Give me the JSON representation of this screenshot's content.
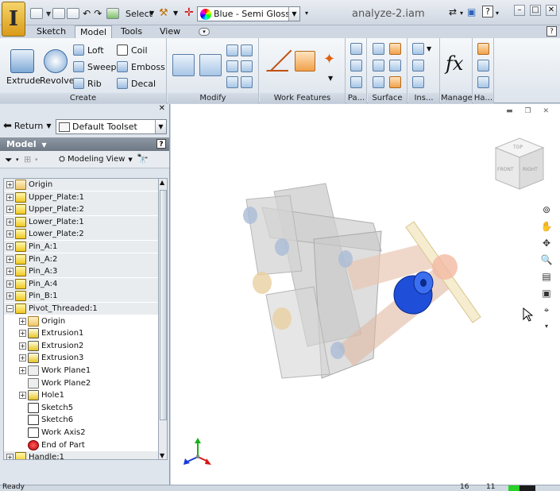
{
  "app": {
    "logo_letter": "I",
    "document_title": "analyze-2.iam",
    "select_label": "Select",
    "color_style": "Blue - Semi Gloss"
  },
  "tabs": [
    {
      "label": "Sketch",
      "active": false
    },
    {
      "label": "Model",
      "active": true
    },
    {
      "label": "Tools",
      "active": false
    },
    {
      "label": "View",
      "active": false
    }
  ],
  "ribbon": {
    "create": {
      "title": "Create",
      "extrude": "Extrude",
      "revolve": "Revolve",
      "loft": "Loft",
      "sweep": "Sweep",
      "rib": "Rib",
      "coil": "Coil",
      "emboss": "Emboss",
      "decal": "Decal"
    },
    "modify": {
      "title": "Modify"
    },
    "work_features": {
      "title": "Work Features"
    },
    "pattern": {
      "title": "Pa..."
    },
    "surface": {
      "title": "Surface"
    },
    "insert": {
      "title": "Ins..."
    },
    "manage": {
      "title": "Manage",
      "fx": "fx"
    },
    "harness": {
      "title": "Ha..."
    }
  },
  "browser": {
    "return_label": "Return",
    "toolset": "Default Toolset",
    "header": "Model",
    "view_mode": "Modeling View",
    "items": [
      {
        "label": "Origin",
        "level": 0,
        "icon": "folder"
      },
      {
        "label": "Upper_Plate:1",
        "level": 0,
        "icon": "part"
      },
      {
        "label": "Upper_Plate:2",
        "level": 0,
        "icon": "part"
      },
      {
        "label": "Lower_Plate:1",
        "level": 0,
        "icon": "part"
      },
      {
        "label": "Lower_Plate:2",
        "level": 0,
        "icon": "part"
      },
      {
        "label": "Pin_A:1",
        "level": 0,
        "icon": "part"
      },
      {
        "label": "Pin_A:2",
        "level": 0,
        "icon": "part"
      },
      {
        "label": "Pin_A:3",
        "level": 0,
        "icon": "part"
      },
      {
        "label": "Pin_A:4",
        "level": 0,
        "icon": "part"
      },
      {
        "label": "Pin_B:1",
        "level": 0,
        "icon": "part"
      },
      {
        "label": "Pivot_Threaded:1",
        "level": 0,
        "icon": "part"
      },
      {
        "label": "Origin",
        "level": 1,
        "icon": "folder"
      },
      {
        "label": "Extrusion1",
        "level": 1,
        "icon": "feature"
      },
      {
        "label": "Extrusion2",
        "level": 1,
        "icon": "feature"
      },
      {
        "label": "Extrusion3",
        "level": 1,
        "icon": "feature"
      },
      {
        "label": "Work Plane1",
        "level": 1,
        "icon": "plane"
      },
      {
        "label": "Work Plane2",
        "level": 1,
        "icon": "plane"
      },
      {
        "label": "Hole1",
        "level": 1,
        "icon": "feature"
      },
      {
        "label": "Sketch5",
        "level": 1,
        "icon": "sketch"
      },
      {
        "label": "Sketch6",
        "level": 1,
        "icon": "sketch"
      },
      {
        "label": "Work Axis2",
        "level": 1,
        "icon": "sketch"
      },
      {
        "label": "End of Part",
        "level": 1,
        "icon": "endpart"
      },
      {
        "label": "Handle:1",
        "level": 0,
        "icon": "part"
      }
    ]
  },
  "viewcube": {
    "top": "TOP",
    "front": "FRONT",
    "right": "RIGHT"
  },
  "status": {
    "text": "Ready",
    "num1": "16",
    "num2": "11"
  }
}
